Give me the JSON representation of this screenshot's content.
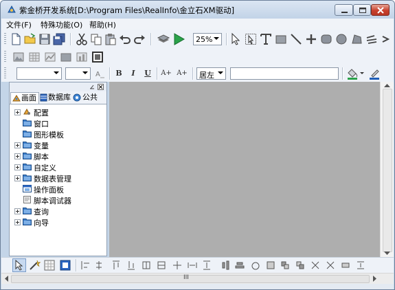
{
  "window": {
    "title": "紫金桥开发系统[D:\\Program Files\\RealInfo\\金立石XM驱动]",
    "icon": "app-icon",
    "controls": [
      "minimize-icon",
      "maximize-icon",
      "close-icon"
    ]
  },
  "menu": {
    "file": "文件(F)",
    "special": "特殊功能(O)",
    "help": "帮助(H)"
  },
  "toolbar1": {
    "zoom": "25%"
  },
  "format_toolbar": {
    "font_name": "",
    "font_size": "",
    "bold": "B",
    "italic": "I",
    "underline": "U",
    "superscript": "A+",
    "superscript2": "A+",
    "align": "居左",
    "text_value": ""
  },
  "panel": {
    "tabs": [
      {
        "label": "画面",
        "icon": "screen-icon"
      },
      {
        "label": "数据库",
        "icon": "database-icon"
      },
      {
        "label": "公共",
        "icon": "gear-icon"
      }
    ],
    "tree": [
      {
        "label": "配置",
        "icon": "config-icon",
        "expandable": true
      },
      {
        "label": "窗口",
        "icon": "folder-icon",
        "expandable": false
      },
      {
        "label": "图形模板",
        "icon": "folder-icon",
        "expandable": false
      },
      {
        "label": "变量",
        "icon": "folder-icon",
        "expandable": true
      },
      {
        "label": "脚本",
        "icon": "folder-icon",
        "expandable": true
      },
      {
        "label": "自定义",
        "icon": "folder-icon",
        "expandable": true
      },
      {
        "label": "数据表管理",
        "icon": "folder-icon",
        "expandable": true
      },
      {
        "label": "操作面板",
        "icon": "panel-icon",
        "expandable": false
      },
      {
        "label": "脚本调试器",
        "icon": "debugger-icon",
        "expandable": false
      },
      {
        "label": "查询",
        "icon": "folder-icon",
        "expandable": true
      },
      {
        "label": "向导",
        "icon": "folder-icon",
        "expandable": true
      }
    ]
  },
  "hscroll": {
    "thumb_label": "III"
  },
  "colors": {
    "canvas": "#aeaeae",
    "accent_blue": "#1e5eb8"
  }
}
